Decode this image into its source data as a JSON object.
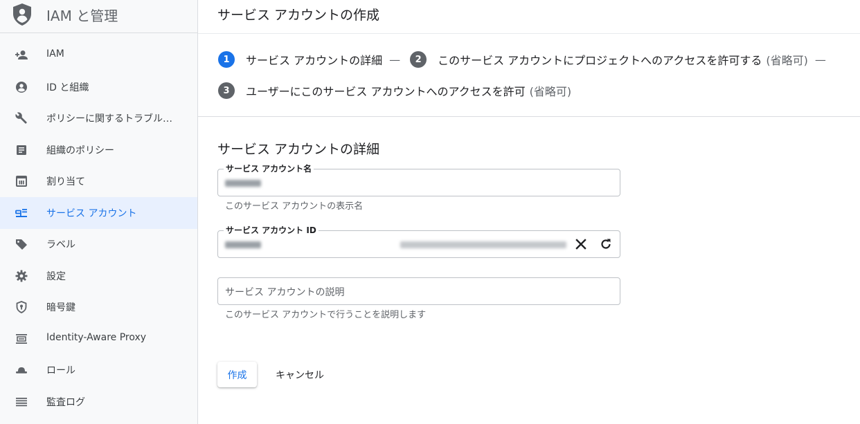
{
  "app": {
    "title": "IAM と管理",
    "brand_color": "#5f6368",
    "accent_color": "#1a73e8"
  },
  "sidebar": {
    "items": [
      {
        "label": "IAM",
        "icon": "person-add-icon",
        "active": false
      },
      {
        "label": "ID と組織",
        "icon": "account-circle-icon",
        "active": false
      },
      {
        "label": "ポリシーに関するトラブル…",
        "icon": "wrench-icon",
        "active": false
      },
      {
        "label": "組織のポリシー",
        "icon": "document-list-icon",
        "active": false
      },
      {
        "label": "割り当て",
        "icon": "quota-icon",
        "active": false
      },
      {
        "label": "サービス アカウント",
        "icon": "service-account-icon",
        "active": true
      },
      {
        "label": "ラベル",
        "icon": "label-tag-icon",
        "active": false
      },
      {
        "label": "設定",
        "icon": "gear-icon",
        "active": false
      },
      {
        "label": "暗号鍵",
        "icon": "shield-key-icon",
        "active": false
      },
      {
        "label": "Identity-Aware Proxy",
        "icon": "proxy-icon",
        "active": false
      },
      {
        "label": "ロール",
        "icon": "hat-icon",
        "active": false
      },
      {
        "label": "監査ログ",
        "icon": "list-lines-icon",
        "active": false
      }
    ]
  },
  "main": {
    "page_title": "サービス アカウントの作成",
    "steps": [
      {
        "num": "1",
        "label": "サービス アカウントの詳細",
        "optional": "",
        "separator": "—"
      },
      {
        "num": "2",
        "label": "このサービス アカウントにプロジェクトへのアクセスを許可する",
        "optional": "(省略可)",
        "separator": "—"
      },
      {
        "num": "3",
        "label": "ユーザーにこのサービス アカウントへのアクセスを許可",
        "optional": "(省略可)",
        "separator": ""
      }
    ],
    "section_title": "サービス アカウントの詳細",
    "fields": {
      "name": {
        "label": "サービス アカウント名",
        "hint": "このサービス アカウントの表示名"
      },
      "id": {
        "label": "サービス アカウント ID"
      },
      "description": {
        "placeholder": "サービス アカウントの説明",
        "hint": "このサービス アカウントで行うことを説明します"
      }
    },
    "buttons": {
      "create": "作成",
      "cancel": "キャンセル"
    }
  }
}
